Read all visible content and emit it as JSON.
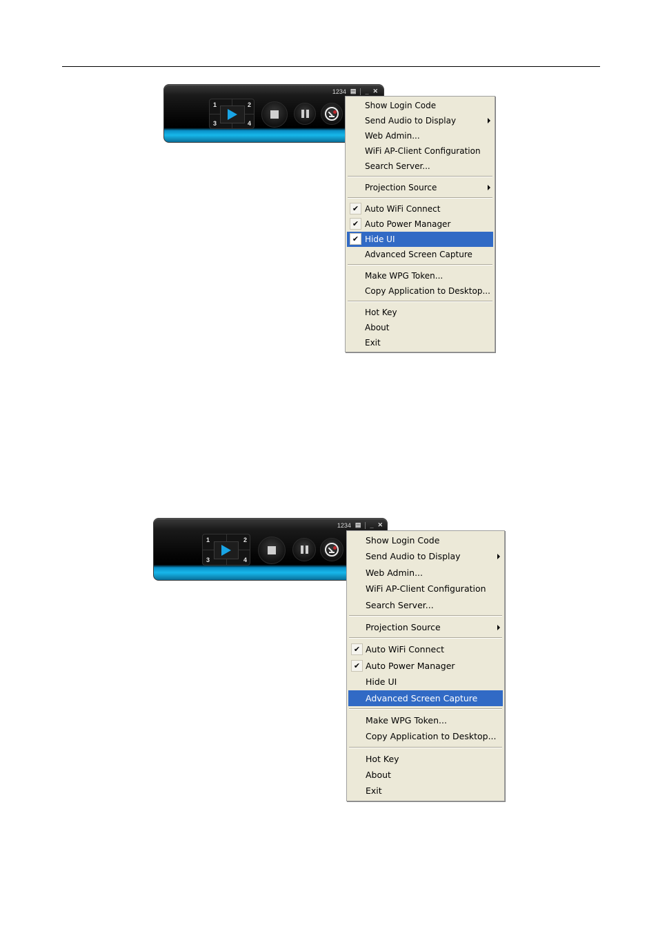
{
  "figures": [
    {
      "player": {
        "code": "1234",
        "list_icon": "list-icon",
        "minimize_icon": "minimize-icon",
        "close_icon": "close-icon",
        "quadrants": [
          "1",
          "2",
          "3",
          "4"
        ],
        "buttons": [
          "play",
          "stop",
          "pause",
          "speed-gauge"
        ]
      },
      "menu": {
        "items": [
          {
            "label": "Show Login Code"
          },
          {
            "label": "Send Audio to Display",
            "submenu": true
          },
          {
            "label": "Web Admin..."
          },
          {
            "label": "WiFi AP-Client Configuration"
          },
          {
            "label": "Search Server..."
          },
          {
            "label": "Projection Source",
            "submenu": true
          },
          {
            "label": "Auto WiFi Connect",
            "checked": true
          },
          {
            "label": "Auto Power Manager",
            "checked": true
          },
          {
            "label": "Hide UI",
            "checked": true,
            "highlighted": true
          },
          {
            "label": "Advanced Screen Capture"
          },
          {
            "label": "Make WPG Token..."
          },
          {
            "label": "Copy Application to Desktop..."
          },
          {
            "label": "Hot Key"
          },
          {
            "label": "About"
          },
          {
            "label": "Exit"
          }
        ]
      }
    },
    {
      "player": {
        "code": "1234",
        "quadrants": [
          "1",
          "2",
          "3",
          "4"
        ]
      },
      "menu": {
        "items": [
          {
            "label": "Show Login Code"
          },
          {
            "label": "Send Audio to Display",
            "submenu": true
          },
          {
            "label": "Web Admin..."
          },
          {
            "label": "WiFi AP-Client Configuration"
          },
          {
            "label": "Search Server..."
          },
          {
            "label": "Projection Source",
            "submenu": true
          },
          {
            "label": "Auto WiFi Connect",
            "checked": true
          },
          {
            "label": "Auto Power Manager",
            "checked": true
          },
          {
            "label": "Hide UI",
            "checked": false
          },
          {
            "label": "Advanced Screen Capture",
            "highlighted": true
          },
          {
            "label": "Make WPG Token..."
          },
          {
            "label": "Copy Application to Desktop..."
          },
          {
            "label": "Hot Key"
          },
          {
            "label": "About"
          },
          {
            "label": "Exit"
          }
        ]
      }
    }
  ],
  "colors": {
    "menu_bg": "#ece9d8",
    "highlight": "#316ac5",
    "accent_blue": "#19a5e6"
  }
}
